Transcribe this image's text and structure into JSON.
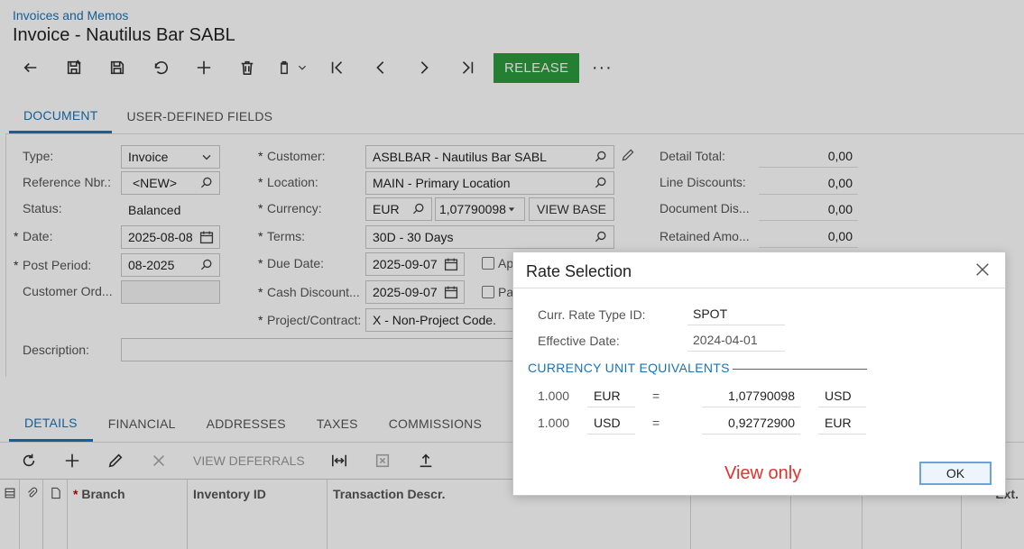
{
  "header": {
    "breadcrumb": "Invoices and Memos",
    "title": "Invoice - Nautilus Bar SABL"
  },
  "toolbar": {
    "release_label": "RELEASE",
    "more_label": "···"
  },
  "main_tabs": [
    {
      "label": "DOCUMENT",
      "active": true
    },
    {
      "label": "USER-DEFINED FIELDS",
      "active": false
    }
  ],
  "form": {
    "type_label": "Type:",
    "type_value": "Invoice",
    "ref_label": "Reference Nbr.:",
    "ref_value": "<NEW>",
    "status_label": "Status:",
    "status_value": "Balanced",
    "date_label": "Date:",
    "date_value": "2025-08-08",
    "post_period_label": "Post Period:",
    "post_period_value": "08-2025",
    "customer_ord_label": "Customer Ord...",
    "customer_ord_value": "",
    "customer_label": "Customer:",
    "customer_value": "ASBLBAR - Nautilus Bar SABL",
    "location_label": "Location:",
    "location_value": "MAIN - Primary Location",
    "currency_label": "Currency:",
    "currency_value": "EUR",
    "rate_value": "1,07790098",
    "view_base_label": "VIEW BASE",
    "terms_label": "Terms:",
    "terms_value": "30D - 30 Days",
    "due_date_label": "Due Date:",
    "due_date_value": "2025-09-07",
    "cash_discount_label": "Cash Discount...",
    "cash_discount_value": "2025-09-07",
    "project_label": "Project/Contract:",
    "project_value": "X - Non-Project Code.",
    "description_label": "Description:",
    "description_value": "",
    "check1_label": "Ap",
    "check2_label": "Pa",
    "detail_total_label": "Detail Total:",
    "detail_total_value": "0,00",
    "line_discounts_label": "Line Discounts:",
    "line_discounts_value": "0,00",
    "document_dis_label": "Document Dis...",
    "document_dis_value": "0,00",
    "retained_amo_label": "Retained Amo...",
    "retained_amo_value": "0,00"
  },
  "grid_tabs": [
    {
      "label": "DETAILS",
      "active": true
    },
    {
      "label": "FINANCIAL",
      "active": false
    },
    {
      "label": "ADDRESSES",
      "active": false
    },
    {
      "label": "TAXES",
      "active": false
    },
    {
      "label": "COMMISSIONS",
      "active": false
    }
  ],
  "grid_toolbar": {
    "view_deferrals_label": "VIEW DEFERRALS"
  },
  "grid_columns": {
    "branch": "Branch",
    "inventory_id": "Inventory ID",
    "transaction_descr": "Transaction Descr.",
    "ext": "Ext."
  },
  "dialog": {
    "title": "Rate Selection",
    "rate_type_label": "Curr. Rate Type ID:",
    "rate_type_value": "SPOT",
    "effective_date_label": "Effective Date:",
    "effective_date_value": "2024-04-01",
    "section_title": "CURRENCY UNIT EQUIVALENTS",
    "rows": [
      {
        "qty": "1.000",
        "from": "EUR",
        "eq": "=",
        "rate": "1,07790098",
        "to": "USD"
      },
      {
        "qty": "1.000",
        "from": "USD",
        "eq": "=",
        "rate": "0,92772900",
        "to": "EUR"
      }
    ],
    "note": "View only",
    "ok_label": "OK"
  }
}
